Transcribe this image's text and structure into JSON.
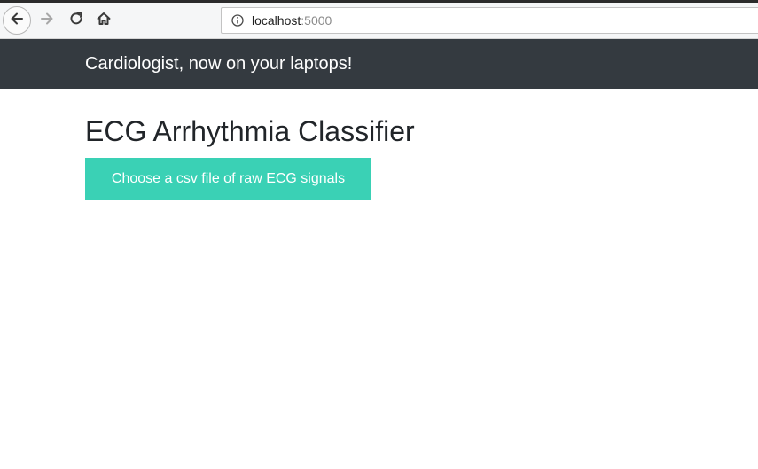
{
  "browser": {
    "url_host": "localhost",
    "url_port": ":5000"
  },
  "navbar": {
    "brand": "Cardiologist, now on your laptops!"
  },
  "main": {
    "title": "ECG Arrhythmia Classifier",
    "upload_button_label": "Choose a csv file of raw ECG signals"
  },
  "colors": {
    "navbar_bg": "#343a40",
    "accent_button": "#3ad1b5"
  },
  "icons": {
    "back": "arrow-left-icon",
    "forward": "arrow-right-icon",
    "reload": "reload-icon",
    "home": "home-icon",
    "info": "info-icon"
  }
}
